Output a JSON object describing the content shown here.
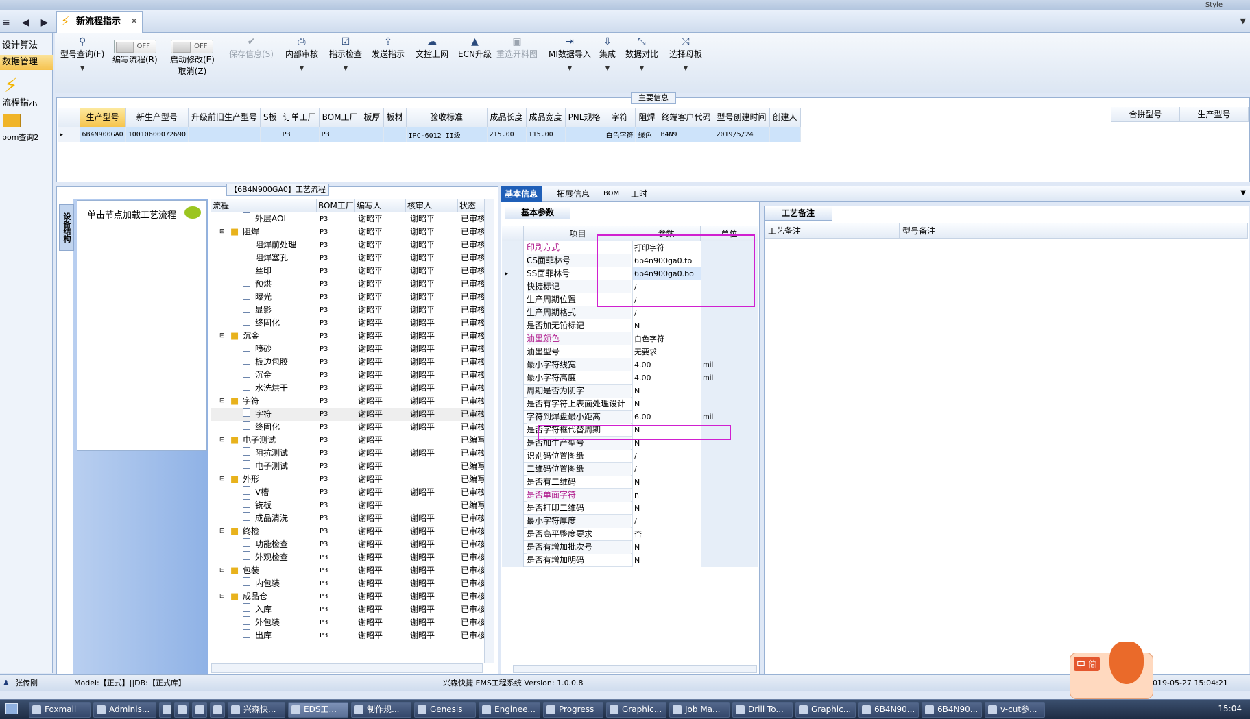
{
  "window": {
    "style_label": "Style"
  },
  "tabs": {
    "active_tab": "新流程指示"
  },
  "left_nav": {
    "items": [
      "设计算法",
      "数据管理",
      "流程指示",
      "bom查询2"
    ]
  },
  "ribbon": {
    "buttons": [
      {
        "label": "型号查询(F)",
        "icon": "search-icon",
        "enabled": true
      },
      {
        "label": "编写流程(R)",
        "toggle": "OFF",
        "enabled": true
      },
      {
        "label": "启动修改(E)",
        "sub": "取消(Z)",
        "toggle": "OFF",
        "enabled": true
      },
      {
        "label": "保存信息(S)",
        "icon": "check-icon",
        "enabled": false
      },
      {
        "label": "内部审核",
        "icon": "printer-icon",
        "enabled": true
      },
      {
        "label": "指示检查",
        "icon": "checkbox-icon",
        "enabled": true
      },
      {
        "label": "发送指示",
        "icon": "upload-icon",
        "enabled": true
      },
      {
        "label": "文控上网",
        "icon": "cloud-upload-icon",
        "enabled": true
      },
      {
        "label": "ECN升级",
        "icon": "ecn-icon",
        "enabled": true
      },
      {
        "label": "重选开料图",
        "icon": "image-icon",
        "enabled": false
      },
      {
        "label": "MI数据导入",
        "icon": "import-icon",
        "enabled": true
      },
      {
        "label": "集成",
        "icon": "download-icon",
        "enabled": true
      },
      {
        "label": "数据对比",
        "icon": "compare-icon",
        "enabled": true
      },
      {
        "label": "选择母板",
        "icon": "shuffle-icon",
        "enabled": true
      }
    ]
  },
  "main_info": {
    "title": "主要信息",
    "columns": [
      "生产型号",
      "新生产型号",
      "升级前旧生产型号",
      "S板",
      "订单工厂",
      "BOM工厂",
      "板厚",
      "板材",
      "验收标准",
      "成品长度",
      "成品宽度",
      "PNL规格",
      "字符",
      "阻焊",
      "终端客户代码",
      "型号创建时间",
      "创建人"
    ],
    "row": [
      "6B4N900GA0",
      "10010600072690",
      "",
      "",
      "P3",
      "P3",
      "",
      "",
      "IPC-6012 II级",
      "215.00",
      "115.00",
      "",
      "白色字符",
      "绿色",
      "B4N9",
      "2019/5/24",
      ""
    ],
    "right_columns": [
      "合拼型号",
      "生产型号"
    ]
  },
  "process": {
    "title": "【6B4N900GA0】工艺流程",
    "side_tab": "设备结构",
    "load_hint": "单击节点加载工艺流程",
    "columns": [
      "流程",
      "BOM工厂",
      "编写人",
      "核审人",
      "状态"
    ],
    "rows": [
      {
        "name": "外层AOI",
        "level": 2,
        "type": "doc",
        "factory": "P3",
        "writer": "谢昭平",
        "reviewer": "谢昭平",
        "status": "已审核"
      },
      {
        "name": "阻焊",
        "level": 1,
        "type": "folder",
        "factory": "P3",
        "writer": "谢昭平",
        "reviewer": "谢昭平",
        "status": "已审核"
      },
      {
        "name": "阻焊前处理",
        "level": 2,
        "type": "doc",
        "factory": "P3",
        "writer": "谢昭平",
        "reviewer": "谢昭平",
        "status": "已审核"
      },
      {
        "name": "阻焊塞孔",
        "level": 2,
        "type": "doc",
        "factory": "P3",
        "writer": "谢昭平",
        "reviewer": "谢昭平",
        "status": "已审核"
      },
      {
        "name": "丝印",
        "level": 2,
        "type": "doc",
        "factory": "P3",
        "writer": "谢昭平",
        "reviewer": "谢昭平",
        "status": "已审核"
      },
      {
        "name": "预烘",
        "level": 2,
        "type": "doc",
        "factory": "P3",
        "writer": "谢昭平",
        "reviewer": "谢昭平",
        "status": "已审核"
      },
      {
        "name": "曝光",
        "level": 2,
        "type": "doc",
        "factory": "P3",
        "writer": "谢昭平",
        "reviewer": "谢昭平",
        "status": "已审核"
      },
      {
        "name": "显影",
        "level": 2,
        "type": "doc",
        "factory": "P3",
        "writer": "谢昭平",
        "reviewer": "谢昭平",
        "status": "已审核"
      },
      {
        "name": "终固化",
        "level": 2,
        "type": "doc",
        "factory": "P3",
        "writer": "谢昭平",
        "reviewer": "谢昭平",
        "status": "已审核"
      },
      {
        "name": "沉金",
        "level": 1,
        "type": "folder",
        "factory": "P3",
        "writer": "谢昭平",
        "reviewer": "谢昭平",
        "status": "已审核"
      },
      {
        "name": "喷砂",
        "level": 2,
        "type": "doc",
        "factory": "P3",
        "writer": "谢昭平",
        "reviewer": "谢昭平",
        "status": "已审核"
      },
      {
        "name": "板边包胶",
        "level": 2,
        "type": "doc",
        "factory": "P3",
        "writer": "谢昭平",
        "reviewer": "谢昭平",
        "status": "已审核"
      },
      {
        "name": "沉金",
        "level": 2,
        "type": "doc",
        "factory": "P3",
        "writer": "谢昭平",
        "reviewer": "谢昭平",
        "status": "已审核"
      },
      {
        "name": "水洗烘干",
        "level": 2,
        "type": "doc",
        "factory": "P3",
        "writer": "谢昭平",
        "reviewer": "谢昭平",
        "status": "已审核"
      },
      {
        "name": "字符",
        "level": 1,
        "type": "folder",
        "factory": "P3",
        "writer": "谢昭平",
        "reviewer": "谢昭平",
        "status": "已审核"
      },
      {
        "name": "字符",
        "level": 2,
        "type": "doc",
        "factory": "P3",
        "writer": "谢昭平",
        "reviewer": "谢昭平",
        "status": "已审核",
        "highlight": true
      },
      {
        "name": "终固化",
        "level": 2,
        "type": "doc",
        "factory": "P3",
        "writer": "谢昭平",
        "reviewer": "谢昭平",
        "status": "已审核"
      },
      {
        "name": "电子测试",
        "level": 1,
        "type": "folder",
        "factory": "P3",
        "writer": "谢昭平",
        "reviewer": "",
        "status": "已编写"
      },
      {
        "name": "阻抗测试",
        "level": 2,
        "type": "doc",
        "factory": "P3",
        "writer": "谢昭平",
        "reviewer": "谢昭平",
        "status": "已审核"
      },
      {
        "name": "电子测试",
        "level": 2,
        "type": "doc",
        "factory": "P3",
        "writer": "谢昭平",
        "reviewer": "",
        "status": "已编写"
      },
      {
        "name": "外形",
        "level": 1,
        "type": "folder",
        "factory": "P3",
        "writer": "谢昭平",
        "reviewer": "",
        "status": "已编写"
      },
      {
        "name": "V槽",
        "level": 2,
        "type": "doc",
        "factory": "P3",
        "writer": "谢昭平",
        "reviewer": "谢昭平",
        "status": "已审核"
      },
      {
        "name": "铣板",
        "level": 2,
        "type": "doc",
        "factory": "P3",
        "writer": "谢昭平",
        "reviewer": "",
        "status": "已编写"
      },
      {
        "name": "成品清洗",
        "level": 2,
        "type": "doc",
        "factory": "P3",
        "writer": "谢昭平",
        "reviewer": "谢昭平",
        "status": "已审核"
      },
      {
        "name": "终检",
        "level": 1,
        "type": "folder",
        "factory": "P3",
        "writer": "谢昭平",
        "reviewer": "谢昭平",
        "status": "已审核"
      },
      {
        "name": "功能检查",
        "level": 2,
        "type": "doc",
        "factory": "P3",
        "writer": "谢昭平",
        "reviewer": "谢昭平",
        "status": "已审核"
      },
      {
        "name": "外观检查",
        "level": 2,
        "type": "doc",
        "factory": "P3",
        "writer": "谢昭平",
        "reviewer": "谢昭平",
        "status": "已审核"
      },
      {
        "name": "包装",
        "level": 1,
        "type": "folder",
        "factory": "P3",
        "writer": "谢昭平",
        "reviewer": "谢昭平",
        "status": "已审核"
      },
      {
        "name": "内包装",
        "level": 2,
        "type": "doc",
        "factory": "P3",
        "writer": "谢昭平",
        "reviewer": "谢昭平",
        "status": "已审核"
      },
      {
        "name": "成品仓",
        "level": 1,
        "type": "folder",
        "factory": "P3",
        "writer": "谢昭平",
        "reviewer": "谢昭平",
        "status": "已审核"
      },
      {
        "name": "入库",
        "level": 2,
        "type": "doc",
        "factory": "P3",
        "writer": "谢昭平",
        "reviewer": "谢昭平",
        "status": "已审核"
      },
      {
        "name": "外包装",
        "level": 2,
        "type": "doc",
        "factory": "P3",
        "writer": "谢昭平",
        "reviewer": "谢昭平",
        "status": "已审核"
      },
      {
        "name": "出库",
        "level": 2,
        "type": "doc",
        "factory": "P3",
        "writer": "谢昭平",
        "reviewer": "谢昭平",
        "status": "已审核"
      }
    ]
  },
  "info_tabs": [
    "基本信息",
    "拓展信息",
    "BOM",
    "工时"
  ],
  "basic_params": {
    "title": "基本参数",
    "columns": [
      "项目",
      "参数",
      "单位"
    ],
    "rows": [
      {
        "k": "印刷方式",
        "v": "打印字符",
        "u": "",
        "pur": true
      },
      {
        "k": "CS面菲林号",
        "v": "6b4n900ga0.to",
        "u": ""
      },
      {
        "k": "SS面菲林号",
        "v": "6b4n900ga0.bo",
        "u": "",
        "current": true
      },
      {
        "k": "快捷标记",
        "v": "/",
        "u": ""
      },
      {
        "k": "生产周期位置",
        "v": "/",
        "u": ""
      },
      {
        "k": "生产周期格式",
        "v": "/",
        "u": ""
      },
      {
        "k": "是否加无铅标记",
        "v": "N",
        "u": ""
      },
      {
        "k": "油墨颜色",
        "v": "白色字符",
        "u": "",
        "pur": true
      },
      {
        "k": "油墨型号",
        "v": "无要求",
        "u": ""
      },
      {
        "k": "最小字符线宽",
        "v": "4.00",
        "u": "mil"
      },
      {
        "k": "最小字符高度",
        "v": "4.00",
        "u": "mil"
      },
      {
        "k": "周期是否为阴字",
        "v": "N",
        "u": ""
      },
      {
        "k": "是否有字符上表面处理设计",
        "v": "N",
        "u": ""
      },
      {
        "k": "字符到焊盘最小距离",
        "v": "6.00",
        "u": "mil"
      },
      {
        "k": "是否字符框代替周期",
        "v": "N",
        "u": ""
      },
      {
        "k": "是否加生产型号",
        "v": "N",
        "u": ""
      },
      {
        "k": "识别码位置图纸",
        "v": "/",
        "u": ""
      },
      {
        "k": "二维码位置图纸",
        "v": "/",
        "u": ""
      },
      {
        "k": "是否有二维码",
        "v": "N",
        "u": ""
      },
      {
        "k": "是否单面字符",
        "v": "n",
        "u": "",
        "pur": true
      },
      {
        "k": "是否打印二维码",
        "v": "N",
        "u": ""
      },
      {
        "k": "最小字符厚度",
        "v": "/",
        "u": ""
      },
      {
        "k": "是否高平整度要求",
        "v": "否",
        "u": ""
      },
      {
        "k": "是否有增加批次号",
        "v": "N",
        "u": ""
      },
      {
        "k": "是否有增加明码",
        "v": "N",
        "u": ""
      }
    ]
  },
  "notes": {
    "tab": "工艺备注",
    "columns": [
      "工艺备注",
      "型号备注"
    ]
  },
  "status_bar": {
    "user": "张传刚",
    "model": "Model:【正式】||DB:【正式库】",
    "system": "兴森快捷 EMS工程系统 Version: 1.0.0.8",
    "datetime": "2019-05-27 15:04:21"
  },
  "mascot": {
    "ime_label": "中 简"
  },
  "taskbar": {
    "items": [
      "Foxmail",
      "Adminis...",
      "",
      "",
      "",
      "",
      "兴森快...",
      "EDS工...",
      "制作规...",
      "Genesis",
      "Enginee...",
      "Progress",
      "Graphic...",
      "Job Ma...",
      "Drill To...",
      "Graphic...",
      "6B4N90...",
      "6B4N90...",
      "v-cut参..."
    ],
    "active": "EDS工...",
    "clock": "15:04"
  },
  "colors": {
    "accent": "#1f5fb8",
    "highlight_box": "#d020d0",
    "selected_header": "#f6c44c",
    "label_purple": "#b01a8c"
  }
}
